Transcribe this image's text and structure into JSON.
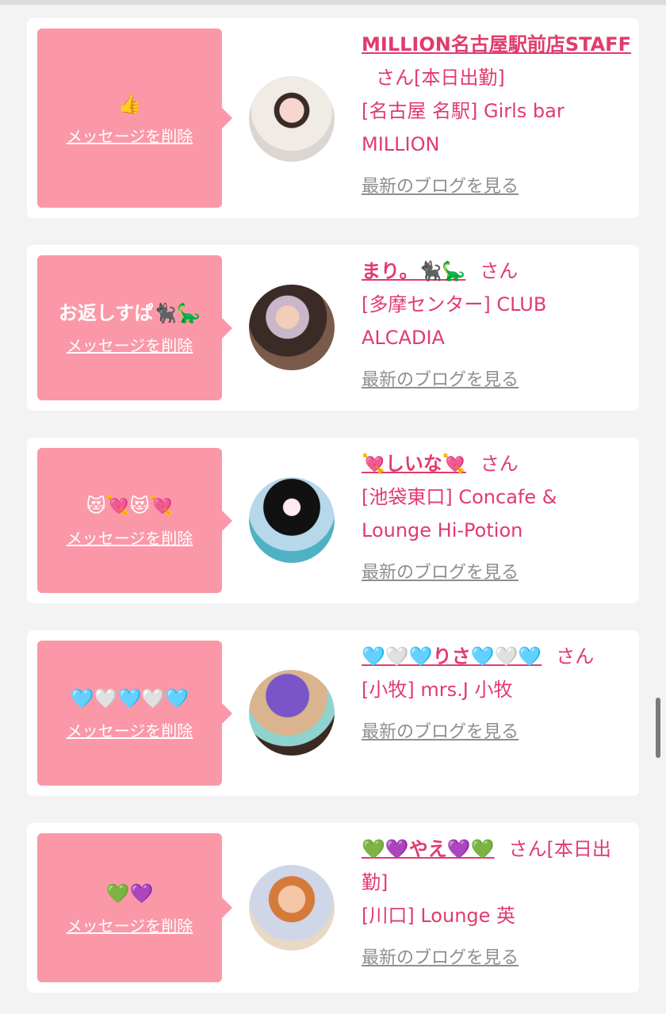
{
  "cards": [
    {
      "message": "👍",
      "delete_label": "メッセージを削除",
      "name": "MILLION名古屋駅前店STAFF",
      "suffix": "さん[本日出勤]",
      "shop": "[名古屋 名駅] Girls bar MILLION",
      "blog_label": "最新のブログを見る"
    },
    {
      "message": "お返しすぱ🐈‍⬛🦕",
      "delete_label": "メッセージを削除",
      "name": "まり。🐈‍⬛🦕",
      "suffix": "さん",
      "shop": "[多摩センター] CLUB ALCADIA",
      "blog_label": "最新のブログを見る"
    },
    {
      "message": "😻💘😻💘",
      "delete_label": "メッセージを削除",
      "name": "💘しいな💘",
      "suffix": "さん",
      "shop": "[池袋東口] Concafe & Lounge Hi-Potion",
      "blog_label": "最新のブログを見る"
    },
    {
      "message": "🩵🤍🩵🤍🩵",
      "delete_label": "メッセージを削除",
      "name": "🩵🤍🩵りさ🩵🤍🩵",
      "suffix": "さん",
      "shop": "[小牧] mrs.J 小牧",
      "blog_label": "最新のブログを見る"
    },
    {
      "message": "💚💜",
      "delete_label": "メッセージを削除",
      "name": "💚💜やえ💜💚",
      "suffix": "さん[本日出勤]",
      "shop": "[川口] Lounge 英",
      "blog_label": "最新のブログを見る"
    }
  ],
  "colors": {
    "accent": "#e13b6c",
    "bubble": "#fb98a8",
    "background": "#f3f3f3",
    "card": "#ffffff",
    "muted_link": "#8e8e8e"
  }
}
